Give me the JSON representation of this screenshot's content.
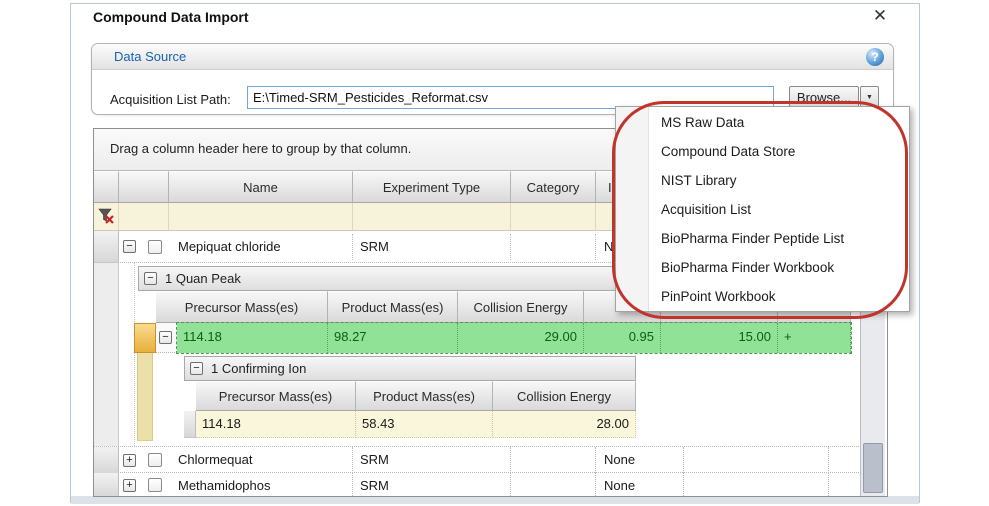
{
  "window": {
    "title": "Compound Data Import"
  },
  "icons": {
    "close": "✕",
    "help": "?",
    "dropdown": "▼",
    "collapse": "−",
    "expand": "+"
  },
  "data_source": {
    "title": "Data Source",
    "path_label": "Acquisition List Path:",
    "path_value": "E:\\Timed-SRM_Pesticides_Reformat.csv",
    "browse_label": "Browse..."
  },
  "menu": {
    "items": [
      "MS Raw Data",
      "Compound Data Store",
      "NIST Library",
      "Acquisition List",
      "BioPharma Finder Peptide List",
      "BioPharma Finder Workbook",
      "PinPoint Workbook"
    ]
  },
  "grid": {
    "group_hint": "Drag a column header here to group by that column.",
    "columns": {
      "name": "Name",
      "experiment_type": "Experiment Type",
      "category": "Category",
      "col4_partial": "I"
    },
    "subcolumns": {
      "precursor": "Precursor Mass(es)",
      "product": "Product Mass(es)",
      "collision": "Collision Energy"
    },
    "quan_band": "1 Quan Peak",
    "quan_row": {
      "precursor": "114.18",
      "product": "98.27",
      "collision": "29.00",
      "extra1": "0.95",
      "extra2": "15.00",
      "extra3": "+"
    },
    "confirming_band": "1 Confirming Ion",
    "confirming_row": {
      "precursor": "114.18",
      "product": "58.43",
      "collision": "28.00"
    },
    "rows": [
      {
        "name": "Mepiquat chloride",
        "type": "SRM",
        "category": "",
        "col4": "None"
      },
      {
        "name": "Chlormequat",
        "type": "SRM",
        "category": "",
        "col4": "None"
      },
      {
        "name": "Methamidophos",
        "type": "SRM",
        "category": "",
        "col4": "None"
      }
    ]
  },
  "colors": {
    "annotation_red": "#c1342b",
    "highlight_green": "#8fe296",
    "filter_row_cream": "#f6f3da",
    "confirm_row_cream": "#faf6dc",
    "data_source_blue": "#1763ae",
    "indicator_amber": "#eec35f"
  }
}
